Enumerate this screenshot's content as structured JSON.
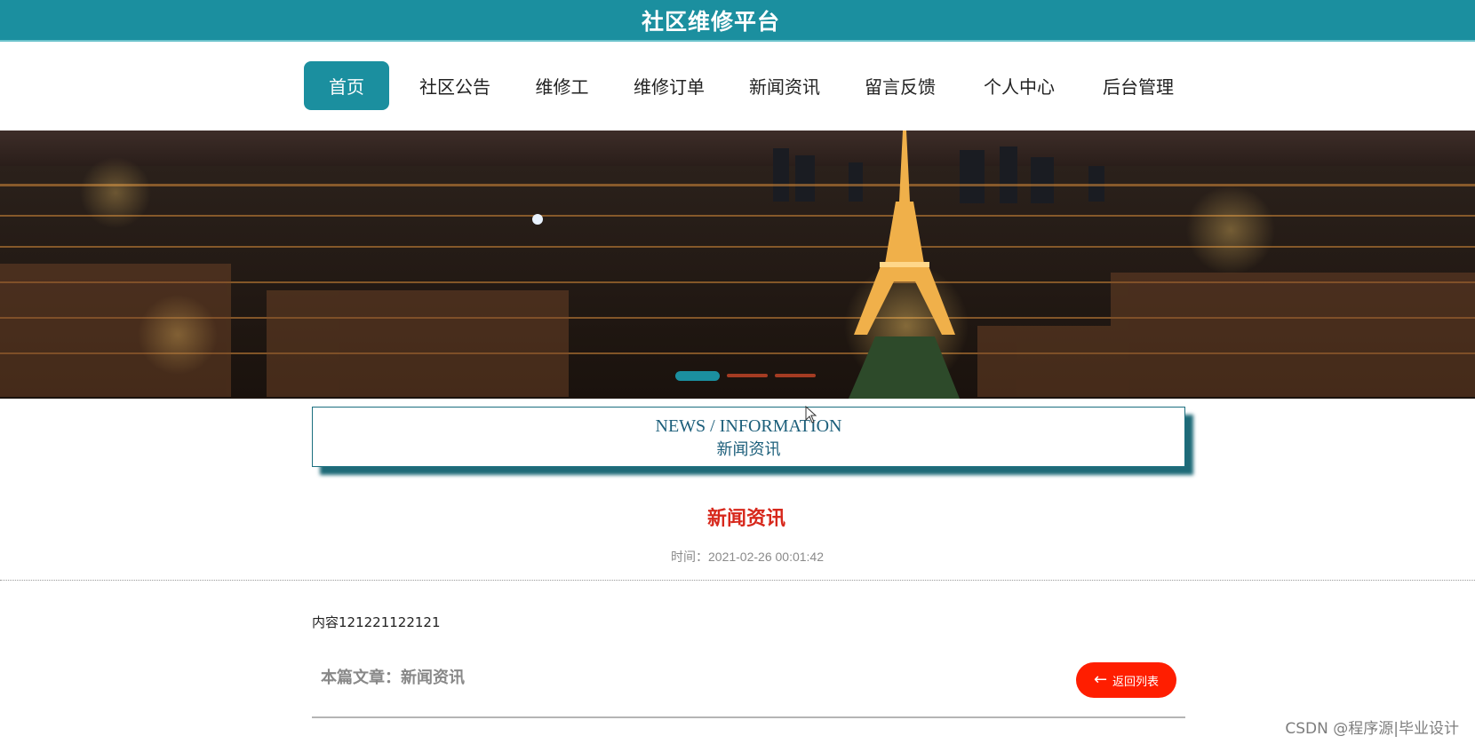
{
  "header": {
    "title": "社区维修平台",
    "bg_color": "#1b8f9f"
  },
  "nav": {
    "items": [
      {
        "label": "首页",
        "active": true
      },
      {
        "label": "社区公告",
        "active": false
      },
      {
        "label": "维修工",
        "active": false
      },
      {
        "label": "维修订单",
        "active": false
      },
      {
        "label": "新闻资讯",
        "active": false
      },
      {
        "label": "留言反馈",
        "active": false
      },
      {
        "label": "个人中心",
        "active": false
      },
      {
        "label": "后台管理",
        "active": false
      }
    ]
  },
  "banner": {
    "image": "night-city-eiffel-tower",
    "slide_count": 3,
    "active_slide": 1
  },
  "section": {
    "title_en": "NEWS / INFORMATION",
    "title_cn": "新闻资讯"
  },
  "article": {
    "title": "新闻资讯",
    "time_label": "时间：",
    "time_value": "2021-02-26 00:01:42",
    "content": "内容121221122121",
    "footer_label": "本篇文章：新闻资讯",
    "back_label": "返回列表",
    "title_color": "#d7281c",
    "back_color": "#ff1e00"
  },
  "watermark": "CSDN @程序源|毕业设计"
}
